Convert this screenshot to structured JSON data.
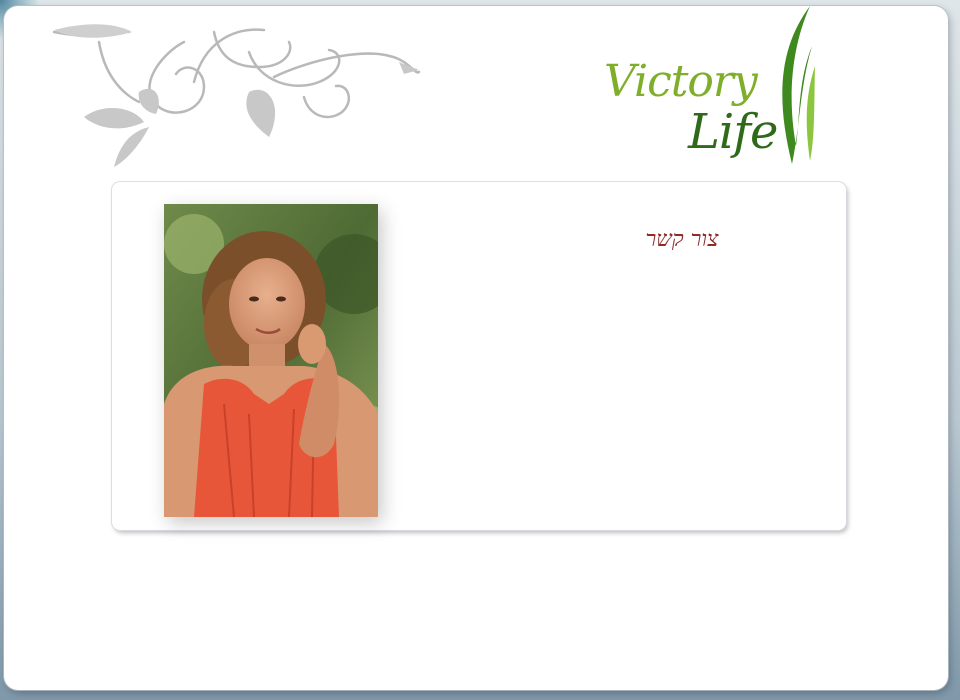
{
  "logo": {
    "line1": "Victory",
    "line2": "Life",
    "colors": {
      "light_green": "#7fae2b",
      "dark_green": "#2f6a1a"
    }
  },
  "decor": {
    "ornament": "floral-swirl-ornament",
    "corner": "blue-corner-swoosh"
  },
  "contact": {
    "heading": "צור קשר",
    "heading_color": "#8e2b2b"
  },
  "photo": {
    "subject": "portrait-photo"
  }
}
